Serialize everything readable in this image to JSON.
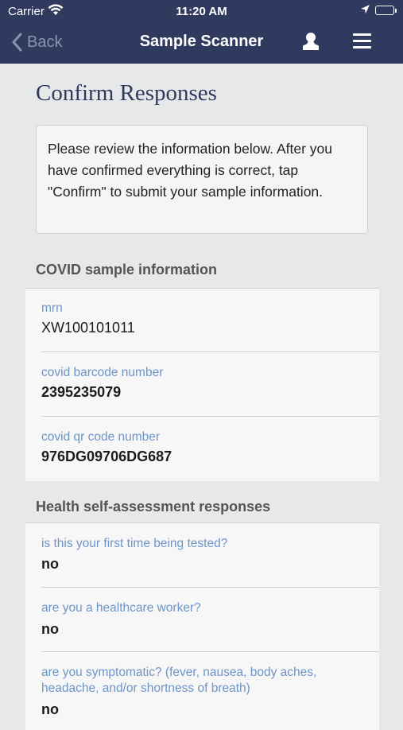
{
  "status_bar": {
    "carrier": "Carrier",
    "time": "11:20 AM"
  },
  "nav": {
    "back_label": "Back",
    "title": "Sample Scanner",
    "icons": [
      "chevron-left-icon",
      "user-icon",
      "menu-icon"
    ]
  },
  "page": {
    "title": "Confirm Responses",
    "intro": "Please review the information below. After you have confirmed everything is correct, tap \"Confirm\" to submit your sample information."
  },
  "sections": [
    {
      "title": "COVID sample information",
      "rows": [
        {
          "label": "mrn",
          "value": "XW100101011"
        },
        {
          "label": "covid barcode number",
          "value": "2395235079"
        },
        {
          "label": "covid qr code number",
          "value": "976DG09706DG687"
        }
      ]
    },
    {
      "title": "Health self-assessment responses",
      "rows": [
        {
          "label": "is this your first time being tested?",
          "value": "no"
        },
        {
          "label": "are you a healthcare worker?",
          "value": "no"
        },
        {
          "label": "are you symptomatic? (fever, nausea, body aches, headache, and/or shortness of breath)",
          "value": "no"
        }
      ]
    }
  ],
  "colors": {
    "header_bg": "#2f3a5e",
    "page_bg": "#e7e8ea",
    "label_blue": "#6d95c8",
    "title_navy": "#2f3a5e"
  }
}
